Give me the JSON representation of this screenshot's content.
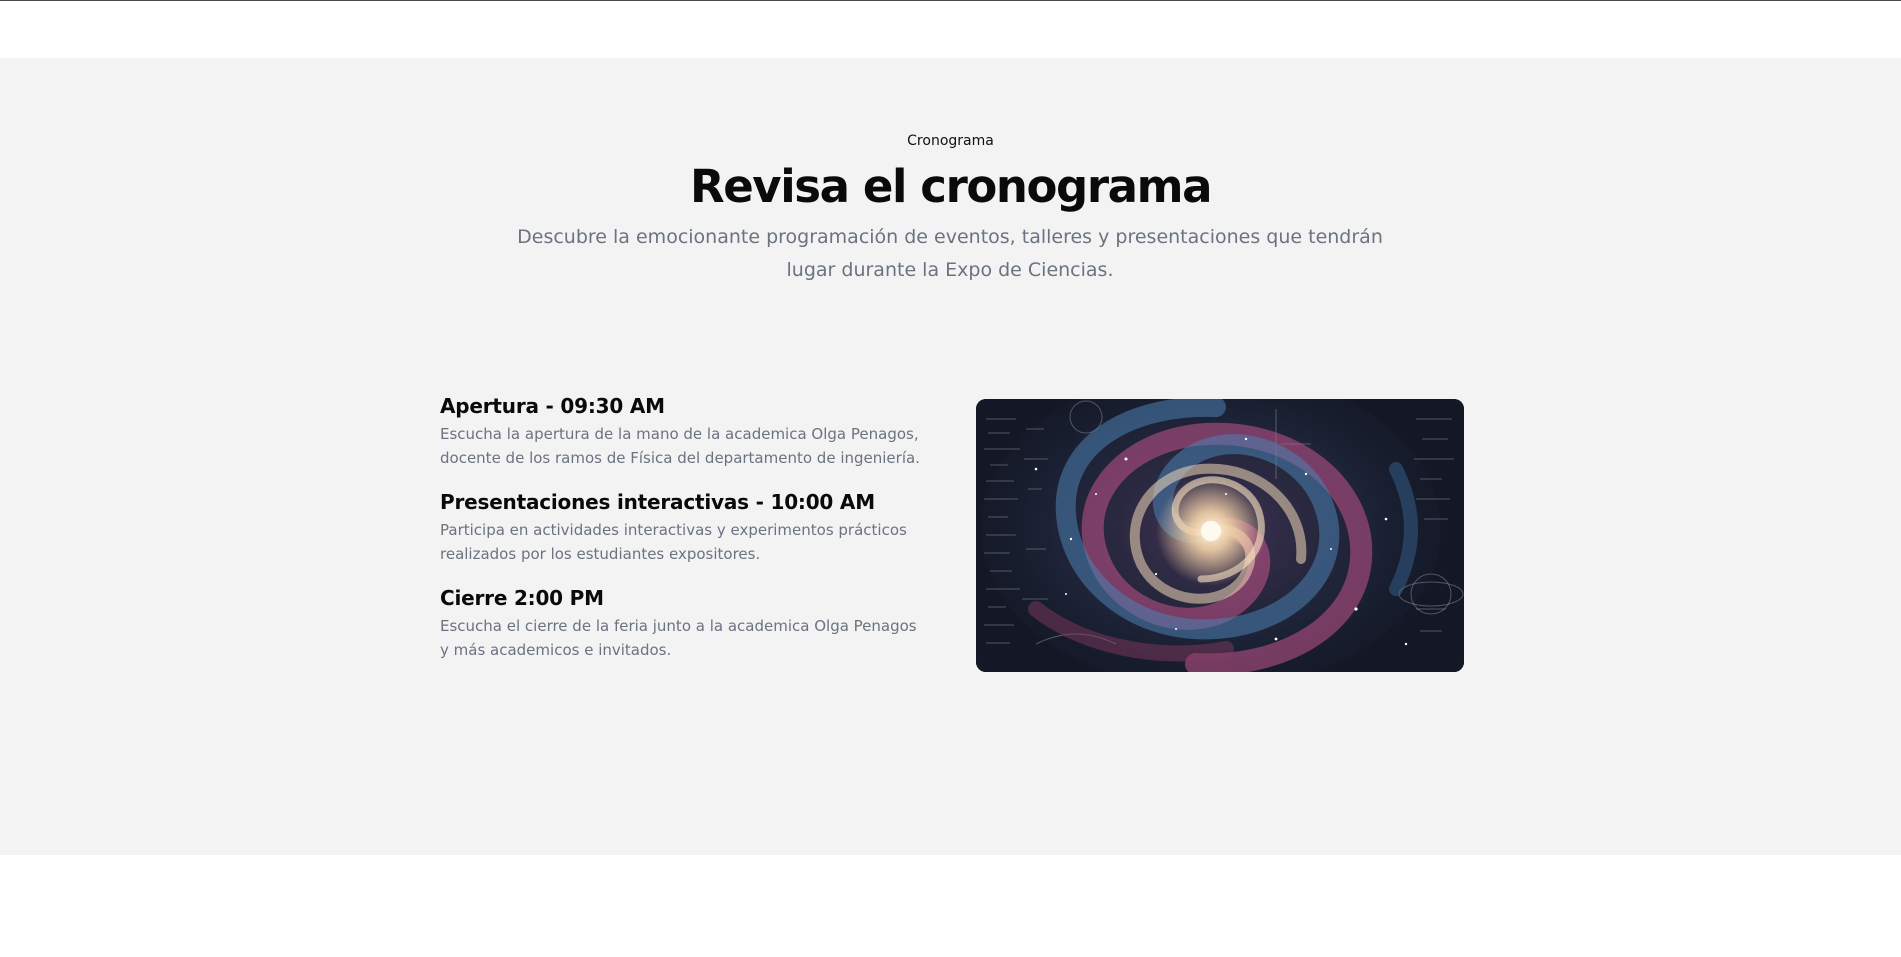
{
  "section": {
    "eyebrow": "Cronograma",
    "title": "Revisa el cronograma",
    "subtitle": "Descubre la emocionante programación de eventos, talleres y presentaciones que tendrán lugar durante la Expo de Ciencias."
  },
  "events": [
    {
      "title": "Apertura - 09:30 AM",
      "description": "Escucha la apertura de la mano de la academica Olga Penagos, docente de los ramos de Física del departamento de ingeniería."
    },
    {
      "title": "Presentaciones interactivas - 10:00 AM",
      "description": "Participa en actividades interactivas y experimentos prácticos realizados por los estudiantes expositores."
    },
    {
      "title": "Cierre 2:00 PM",
      "description": "Escucha el cierre de la feria junto a la academica Olga Penagos y más academicos e invitados."
    }
  ],
  "image": {
    "icon": "spiral-galaxy-illustration",
    "colors": {
      "background": "#141826",
      "core": "#fff1d6",
      "pink": "#c2548a",
      "blue": "#4a7fb0",
      "cream": "#f0d7b8"
    }
  },
  "colors": {
    "section_background": "#f3f3f3",
    "heading": "#0a0a0a",
    "muted_text": "#6b7280"
  }
}
